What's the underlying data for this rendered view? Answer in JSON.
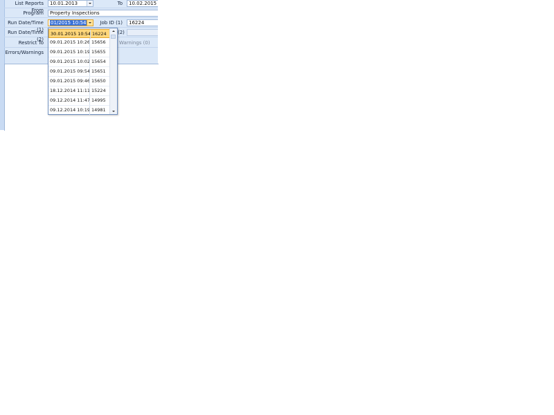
{
  "form": {
    "list_reports_from_label": "List Reports From",
    "list_reports_from_value": "10.01.2013",
    "to_label": "To",
    "to_value": "10.02.2015",
    "program_label": "Program",
    "program_value": "Property Inspections",
    "run_dt1_label": "Run Date/Time (1)",
    "run_dt1_value": "01/2015 10:54:00",
    "job_id1_label": "Job ID (1)",
    "job_id1_value": "16224",
    "run_dt2_label": "Run Date/Time (2)",
    "job_id2_partial": "(2)",
    "restrict_to_label": "Restrict To",
    "restrict_partial": "Warnings (0)",
    "errors_warnings_label": "Errors/Warnings"
  },
  "dropdown": {
    "rows": [
      {
        "date": "30.01.2015 10:54",
        "job": "16224",
        "selected": true
      },
      {
        "date": "09.01.2015 10:26",
        "job": "15656"
      },
      {
        "date": "09.01.2015 10:19",
        "job": "15655"
      },
      {
        "date": "09.01.2015 10:02",
        "job": "15654"
      },
      {
        "date": "09.01.2015 09:54",
        "job": "15651"
      },
      {
        "date": "09.01.2015 09:46",
        "job": "15650"
      },
      {
        "date": "18.12.2014 11:11",
        "job": "15224"
      },
      {
        "date": "09.12.2014 11:47",
        "job": "14995"
      },
      {
        "date": "09.12.2014 10:19",
        "job": "14981"
      }
    ]
  }
}
